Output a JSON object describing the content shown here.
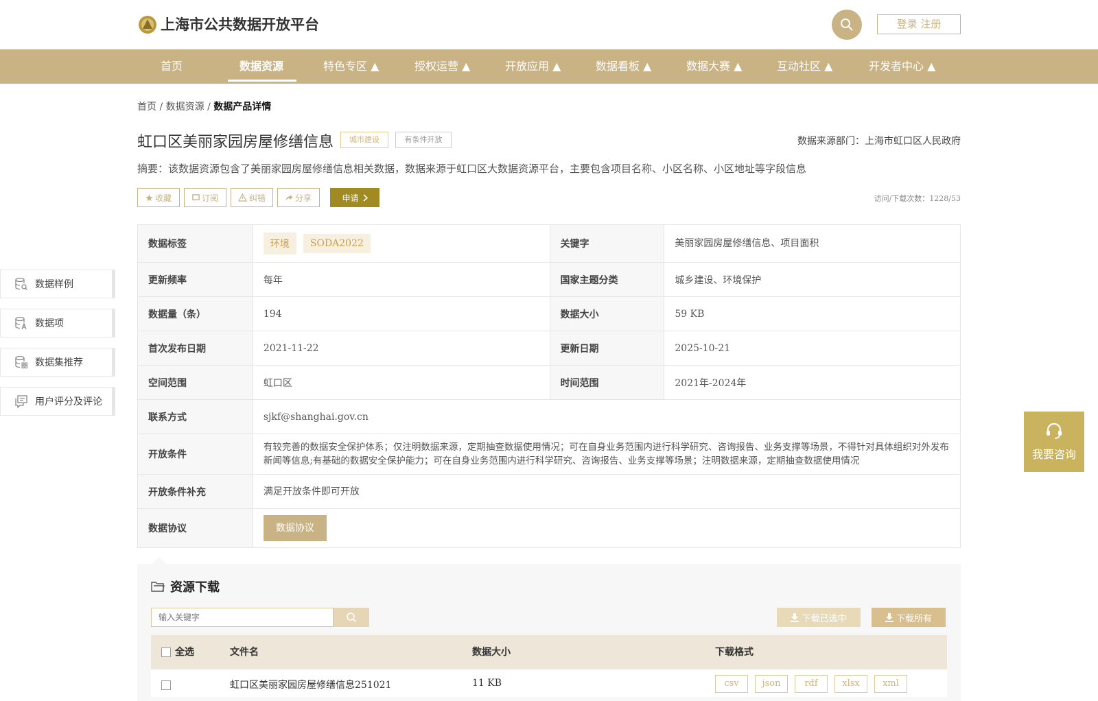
{
  "header": {
    "logo_text": "上海市公共数据开放平台",
    "login_label": "登录 注册"
  },
  "nav": {
    "items": [
      {
        "label": "首页"
      },
      {
        "label": "数据资源"
      },
      {
        "label": "特色专区 ▲"
      },
      {
        "label": "授权运营 ▲"
      },
      {
        "label": "开放应用 ▲"
      },
      {
        "label": "数据看板 ▲"
      },
      {
        "label": "数据大赛 ▲"
      },
      {
        "label": "互动社区 ▲"
      },
      {
        "label": "开发者中心 ▲"
      }
    ]
  },
  "breadcrumb": {
    "home": "首页",
    "sep": "/",
    "resources": "数据资源",
    "current": "数据产品详情"
  },
  "product": {
    "title": "虹口区美丽家园房屋修缮信息",
    "tag_category": "城市建设",
    "tag_open": "有条件开放",
    "source_dept": "数据来源部门：上海市虹口区人民政府",
    "abstract": "摘要：该数据资源包含了美丽家园房屋修缮信息相关数据，数据来源于虹口区大数据资源平台，主要包含项目名称、小区名称、小区地址等字段信息",
    "visits": "访问/下载次数：1228/53"
  },
  "actions": {
    "favorite": "收藏",
    "subscribe": "订阅",
    "correct": "纠错",
    "share": "分享",
    "apply": "申请"
  },
  "info": {
    "tags_label": "数据标签",
    "tags": [
      "环境",
      "SODA2022"
    ],
    "keywords_label": "关键字",
    "keywords": "美丽家园房屋修缮信息、项目面积",
    "freq_label": "更新频率",
    "freq": "每年",
    "theme_label": "国家主题分类",
    "theme": "城乡建设、环境保护",
    "count_label": "数据量（条）",
    "count": "194",
    "size_label": "数据大小",
    "size": "59 KB",
    "first_pub_label": "首次发布日期",
    "first_pub": "2021-11-22",
    "update_label": "更新日期",
    "update": "2025-10-21",
    "space_label": "空间范围",
    "space": "虹口区",
    "time_label": "时间范围",
    "time": "2021年-2024年",
    "contact_label": "联系方式",
    "contact": "sjkf@shanghai.gov.cn",
    "condition_label": "开放条件",
    "condition": "有较完善的数据安全保护体系；仅注明数据来源，定期抽查数据使用情况；可在自身业务范围内进行科学研究、咨询报告、业务支撑等场景，不得针对具体组织对外发布新闻等信息;有基础的数据安全保护能力；可在自身业务范围内进行科学研究、咨询报告、业务支撑等场景；注明数据来源，定期抽查数据使用情况",
    "condition_extra_label": "开放条件补充",
    "condition_extra": "满足开放条件即可开放",
    "protocol_label": "数据协议",
    "protocol_btn": "数据协议"
  },
  "side_menu": [
    {
      "label": "数据样例",
      "icon": "database-search-icon"
    },
    {
      "label": "数据项",
      "icon": "database-text-icon"
    },
    {
      "label": "数据集推荐",
      "icon": "database-grid-icon"
    },
    {
      "label": "用户评分及评论",
      "icon": "comment-icon"
    }
  ],
  "consult": {
    "label": "我要咨询"
  },
  "resource": {
    "title": "资源下载",
    "search_placeholder": "输入关键字",
    "download_selected": "下载已选中",
    "download_all": "下载所有",
    "columns": {
      "select_all": "全选",
      "filename": "文件名",
      "size": "数据大小",
      "formats": "下载格式"
    },
    "rows": [
      {
        "filename": "虹口区美丽家园房屋修缮信息251021",
        "size": "11 KB",
        "formats": [
          "csv",
          "json",
          "rdf",
          "xlsx",
          "xml"
        ]
      }
    ]
  },
  "colors": {
    "brand": "#c9b283",
    "apply": "#9f8b22",
    "consult": "#c9b35e"
  }
}
